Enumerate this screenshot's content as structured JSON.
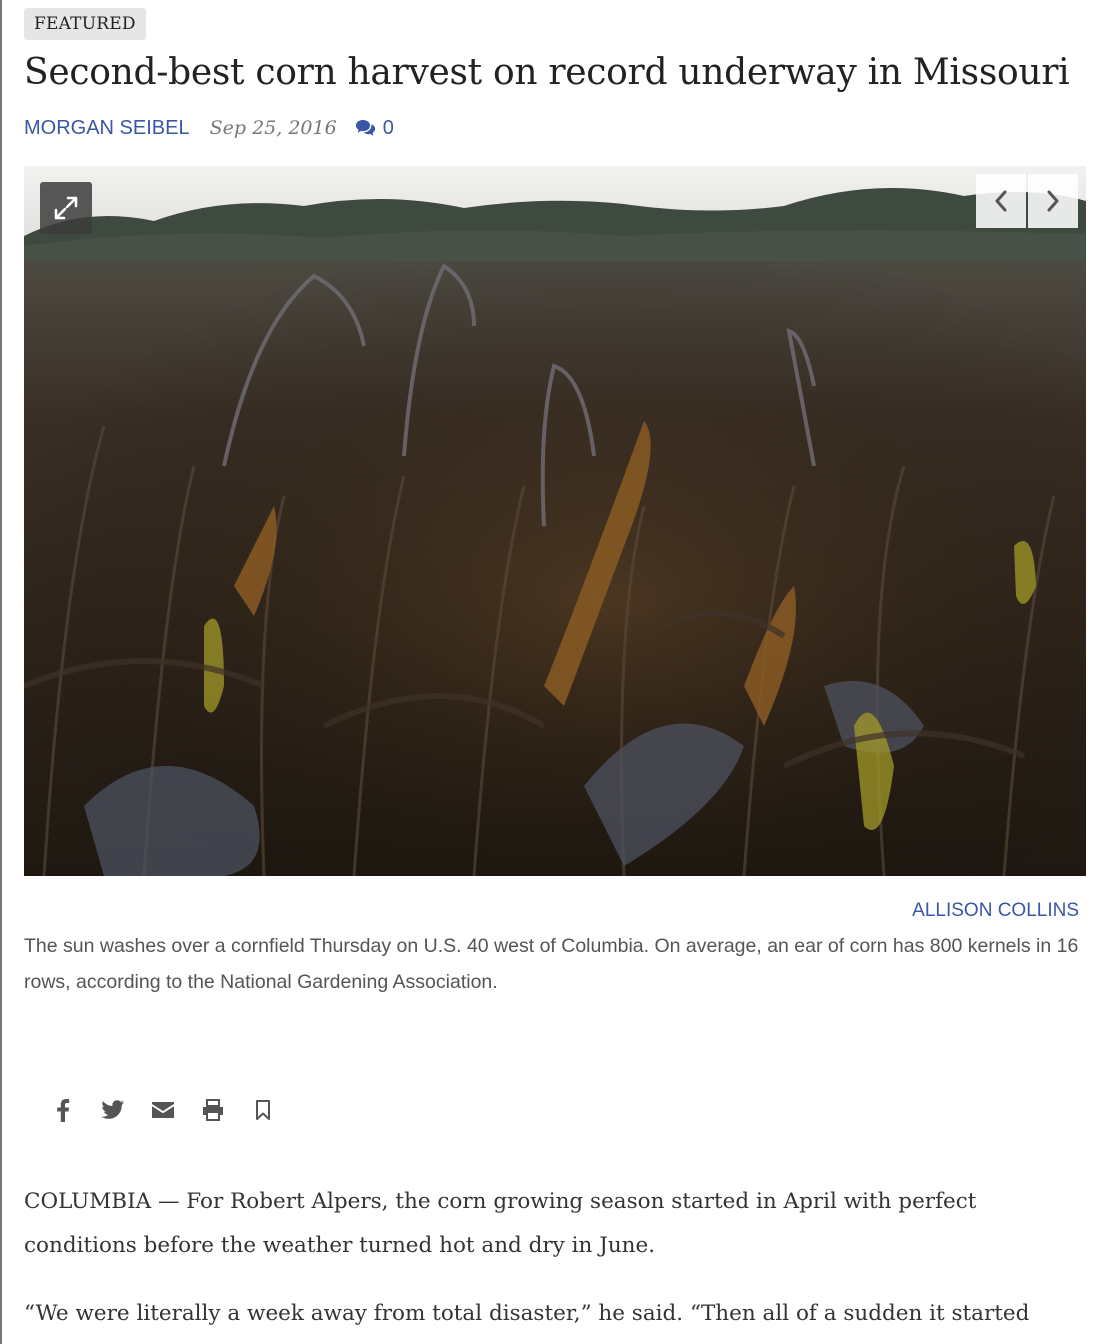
{
  "article": {
    "badge": "FEATURED",
    "headline": "Second-best corn harvest on record underway in Missouri",
    "author": "MORGAN SEIBEL",
    "date": "Sep 25, 2016",
    "comment_count": "0"
  },
  "photo": {
    "credit": "ALLISON COLLINS",
    "caption": "The sun washes over a cornfield Thursday on U.S. 40 west of Columbia. On average, an ear of corn has 800 kernels in 16 rows, according to the National Gardening Association.",
    "icons": {
      "expand": "expand-icon",
      "prev": "chevron-left-icon",
      "next": "chevron-right-icon"
    }
  },
  "share": [
    "facebook-icon",
    "twitter-icon",
    "envelope-icon",
    "print-icon",
    "bookmark-icon"
  ],
  "body": {
    "paragraphs": [
      "COLUMBIA — For Robert Alpers, the corn growing season started in April with perfect conditions before the weather turned hot and dry in June.",
      "“We were literally a week away from total disaster,” he said. “Then all of a sudden it started"
    ]
  },
  "colors": {
    "link": "#3a56a6",
    "text": "#333333",
    "caption": "#555555",
    "badge_bg": "#e6e6e6"
  }
}
